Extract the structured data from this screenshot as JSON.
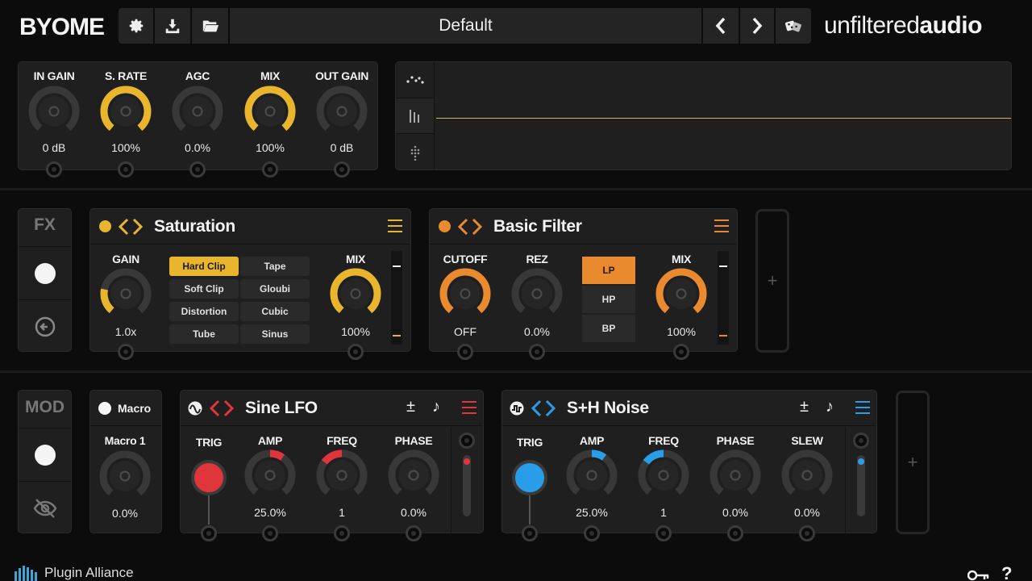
{
  "brand": {
    "logo": "BYOME",
    "company": "unfiltered",
    "company_bold": "audio",
    "footer": "Plugin Alliance"
  },
  "toolbar": {
    "preset": "Default",
    "icons": [
      "gear-icon",
      "download-icon",
      "folder-icon",
      "chevron-left-icon",
      "chevron-right-icon",
      "dice-icon"
    ]
  },
  "io": {
    "knobs": [
      {
        "label": "IN GAIN",
        "value": "0 dB",
        "fill": 0.0,
        "color": "#e8b52d"
      },
      {
        "label": "S. RATE",
        "value": "100%",
        "fill": 1.0,
        "color": "#e8b52d"
      },
      {
        "label": "AGC",
        "value": "0.0%",
        "fill": 0.0,
        "color": "#e8b52d"
      },
      {
        "label": "MIX",
        "value": "100%",
        "fill": 1.0,
        "color": "#e8b52d"
      },
      {
        "label": "OUT GAIN",
        "value": "0 dB",
        "fill": 0.0,
        "color": "#e8b52d"
      }
    ]
  },
  "fx_side": {
    "label": "FX"
  },
  "mod_side": {
    "label": "MOD"
  },
  "saturation": {
    "title": "Saturation",
    "accent": "#e8b52d",
    "gain": {
      "label": "GAIN",
      "value": "1.0x",
      "fill": 0.22
    },
    "mix": {
      "label": "MIX",
      "value": "100%",
      "fill": 1.0
    },
    "modes": [
      "Hard Clip",
      "Tape",
      "Soft Clip",
      "Gloubi",
      "Distortion",
      "Cubic",
      "Tube",
      "Sinus"
    ],
    "selected_mode": "Hard Clip"
  },
  "filter": {
    "title": "Basic Filter",
    "accent": "#e88a2d",
    "cutoff": {
      "label": "CUTOFF",
      "value": "OFF",
      "fill": 1.0
    },
    "rez": {
      "label": "REZ",
      "value": "0.0%",
      "fill": 0.0
    },
    "mix": {
      "label": "MIX",
      "value": "100%",
      "fill": 1.0
    },
    "types": [
      "LP",
      "HP",
      "BP"
    ],
    "selected_type": "LP"
  },
  "macro": {
    "title": "Macro",
    "knob_label": "Macro 1",
    "value": "0.0%",
    "fill": 0.0
  },
  "lfo": {
    "title": "Sine LFO",
    "accent": "#e0353a",
    "trig": "TRIG",
    "knobs": [
      {
        "label": "AMP",
        "value": "25.0%",
        "fill": 0.25,
        "mode": "right"
      },
      {
        "label": "FREQ",
        "value": "1",
        "fill": 0.38,
        "mode": "left"
      },
      {
        "label": "PHASE",
        "value": "0.0%",
        "fill": 0.0,
        "mode": "right"
      }
    ],
    "plusminus": "±",
    "note": "♪"
  },
  "noise": {
    "title": "S+H Noise",
    "accent": "#2a9de8",
    "trig": "TRIG",
    "knobs": [
      {
        "label": "AMP",
        "value": "25.0%",
        "fill": 0.25,
        "mode": "right"
      },
      {
        "label": "FREQ",
        "value": "1",
        "fill": 0.38,
        "mode": "left"
      },
      {
        "label": "PHASE",
        "value": "0.0%",
        "fill": 0.0,
        "mode": "right"
      },
      {
        "label": "SLEW",
        "value": "0.0%",
        "fill": 0.0,
        "mode": "right"
      }
    ],
    "plusminus": "±",
    "note": "♪"
  },
  "add": "+",
  "help": "?"
}
